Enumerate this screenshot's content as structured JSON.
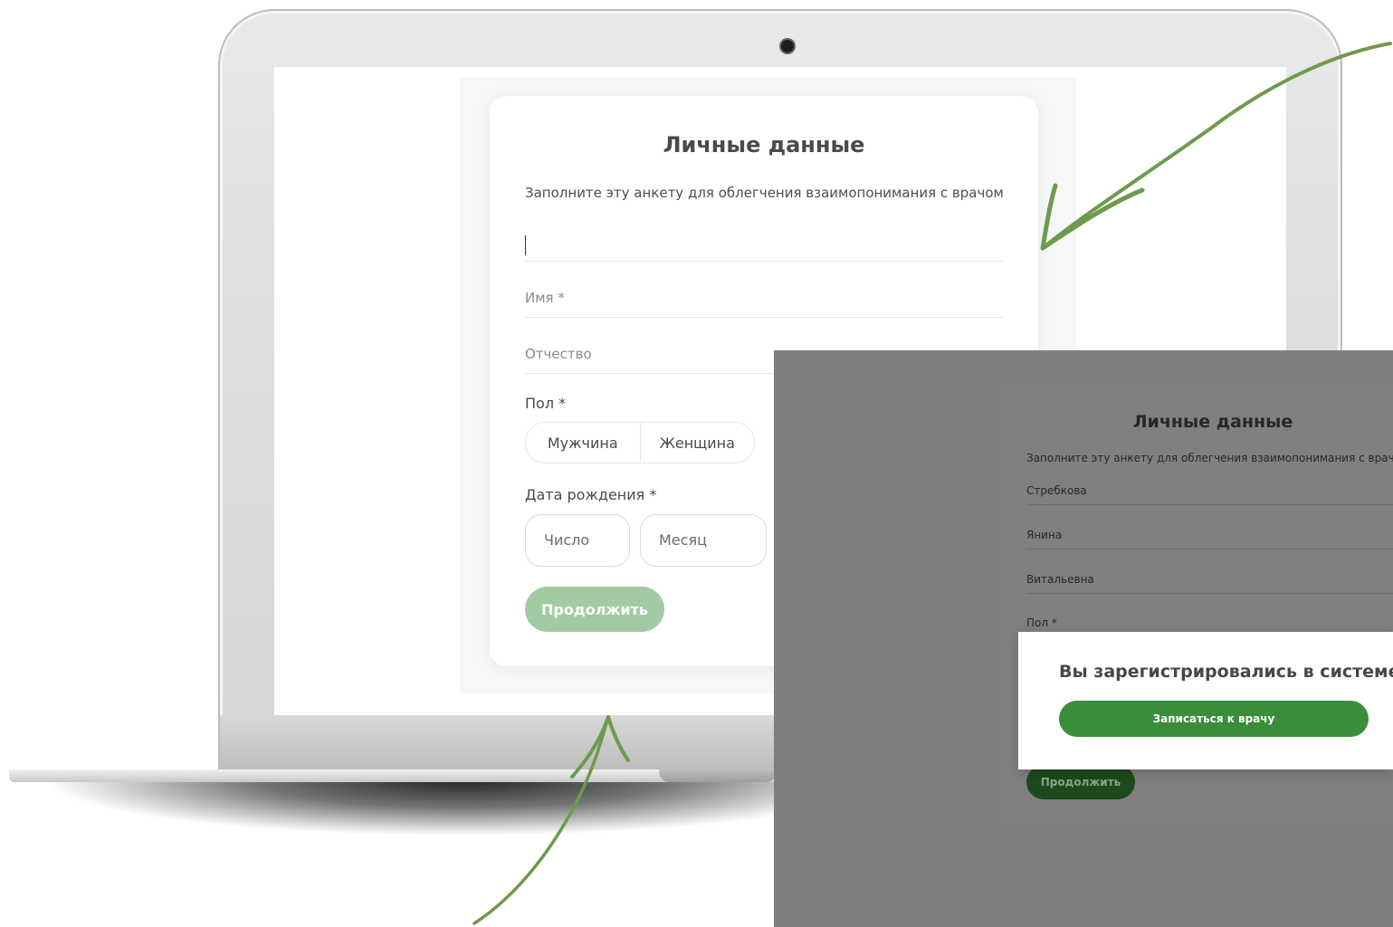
{
  "form": {
    "title": "Личные данные",
    "subtitle": "Заполните эту анкету для облегчения взаимопонимания с врачом",
    "name_placeholder": "Имя *",
    "patronymic_placeholder": "Отчество",
    "gender_label": "Пол *",
    "gender_options": [
      "Мужчина",
      "Женщина"
    ],
    "birthdate_label": "Дата рождения *",
    "day_placeholder": "Число",
    "month_placeholder": "Месяц",
    "continue_label": "Продолжить"
  },
  "overlay": {
    "title": "Личные данные",
    "subtitle": "Заполните эту анкету для облегчения взаимопонимания с врачо",
    "surname_value": "Стребкова",
    "name_value": "Янина",
    "patronymic_value": "Витальевна",
    "gender_label": "Пол *",
    "continue_label": "Продолжить",
    "modal": {
      "message": "Вы зарегистрировались в системе",
      "button_label": "Записаться к врачу"
    }
  },
  "colors": {
    "accent_green": "#3a8d3a",
    "continue_disabled": "#a3cba3",
    "arrow_green": "#6f9a4c"
  }
}
